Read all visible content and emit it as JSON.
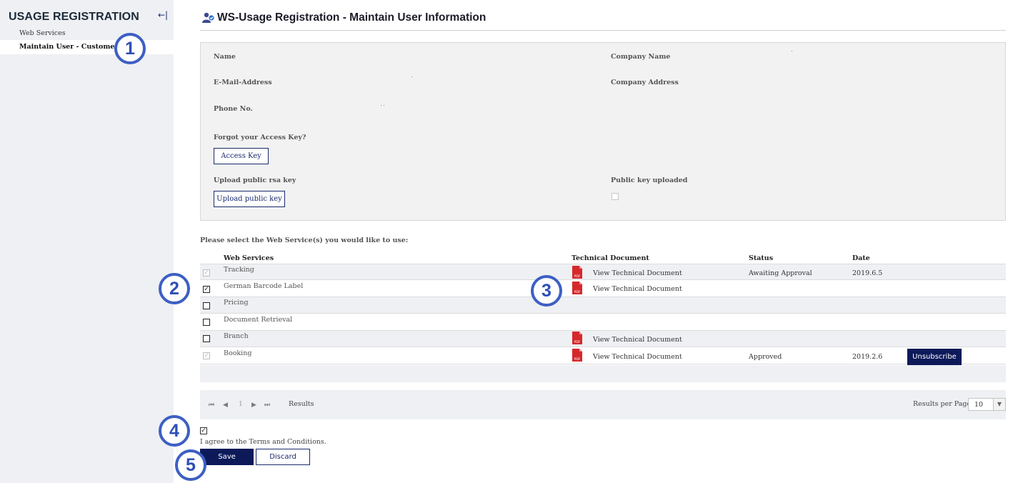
{
  "sidebar": {
    "title": "USAGE REGISTRATION",
    "collapse_icon": "←|",
    "items": [
      {
        "label": "Web Services"
      },
      {
        "label": "Maintain User - Customer"
      }
    ]
  },
  "callouts": [
    "1",
    "2",
    "3",
    "4",
    "5"
  ],
  "header": {
    "icon": "users-icon",
    "title": "WS-Usage Registration - Maintain User Information"
  },
  "panel": {
    "name_label": "Name",
    "company_name_label": "Company Name",
    "email_label": "E-Mail-Address",
    "company_address_label": "Company Address",
    "phone_label": "Phone No.",
    "forgot_label": "Forgot your Access Key?",
    "access_key_button": "Access Key",
    "upload_label": "Upload public rsa key",
    "upload_button": "Upload public key",
    "uploaded_label": "Public key uploaded",
    "uploaded_checked": false
  },
  "section_label": "Please select the Web Service(s) you would like to use:",
  "table": {
    "columns": [
      "Web Services",
      "Technical Document",
      "Status",
      "Date"
    ],
    "rows": [
      {
        "service": "Tracking",
        "checked": true,
        "disabled": true,
        "doc": "View Technical Document",
        "status": "Awaiting Approval",
        "date": "2019.6.5",
        "action": ""
      },
      {
        "service": "German Barcode Label",
        "checked": true,
        "disabled": false,
        "doc": "View Technical Document",
        "status": "",
        "date": "",
        "action": ""
      },
      {
        "service": "Pricing",
        "checked": false,
        "disabled": false,
        "doc": "",
        "status": "",
        "date": "",
        "action": ""
      },
      {
        "service": "Document Retrieval",
        "checked": false,
        "disabled": false,
        "doc": "",
        "status": "",
        "date": "",
        "action": ""
      },
      {
        "service": "Branch",
        "checked": false,
        "disabled": false,
        "doc": "View Technical Document",
        "status": "",
        "date": "",
        "action": ""
      },
      {
        "service": "Booking",
        "checked": true,
        "disabled": true,
        "doc": "View Technical Document",
        "status": "Approved",
        "date": "2019.2.6",
        "action": "Unsubscribe"
      }
    ]
  },
  "pager": {
    "first_icon": "⏮",
    "prev_icon": "◀",
    "page": "1",
    "next_icon": "▶",
    "last_icon": "⏭",
    "results_label": "Results",
    "rpp_label": "Results per Page",
    "rpp_value": "10"
  },
  "terms": {
    "checked": true,
    "label": "I agree to the Terms and Conditions."
  },
  "actions": {
    "save": "Save",
    "discard": "Discard"
  },
  "colors": {
    "navy": "#0d1a5a",
    "callout": "#3d5fc4",
    "pdf_red": "#d6282b"
  }
}
